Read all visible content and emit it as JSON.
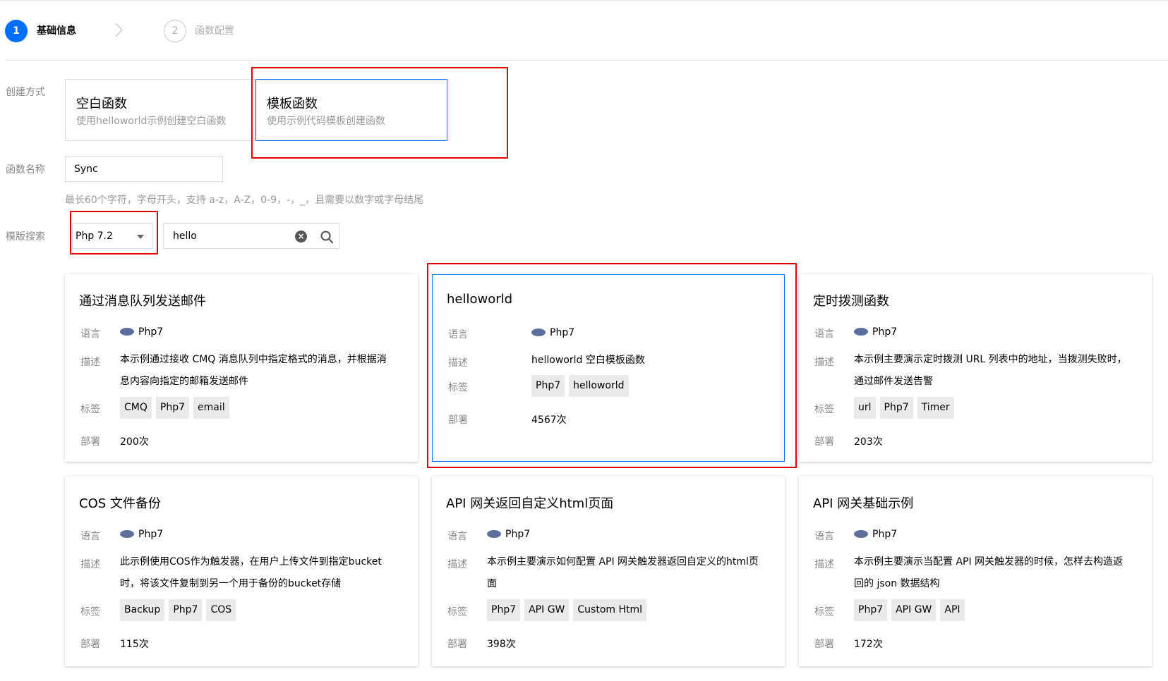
{
  "steps": [
    {
      "number": "1",
      "label": "基础信息"
    },
    {
      "number": "2",
      "label": "函数配置"
    }
  ],
  "form": {
    "creation_method_label": "创建方式",
    "function_name_label": "函数名称",
    "template_search_label": "模版搜索",
    "function_name_value": "Sync",
    "function_name_hint": "最长60个字符，字母开头，支持 a-z，A-Z，0-9，-，_，且需要以数字或字母结尾"
  },
  "methods": [
    {
      "title": "空白函数",
      "desc": "使用helloworld示例创建空白函数"
    },
    {
      "title": "模板函数",
      "desc": "使用示例代码模板创建函数"
    }
  ],
  "search": {
    "runtime_selected": "Php 7.2",
    "query": "hello"
  },
  "row_labels": {
    "language": "语言",
    "description": "描述",
    "tags": "标签",
    "deploys": "部署"
  },
  "templates": [
    {
      "title": "通过消息队列发送邮件",
      "language": "Php7",
      "desc": "本示例通过接收 CMQ 消息队列中指定格式的消息，并根据消息内容向指定的邮箱发送邮件",
      "tags": [
        "CMQ",
        "Php7",
        "email"
      ],
      "deploys": "200次"
    },
    {
      "title": "helloworld",
      "language": "Php7",
      "desc": "helloworld 空白模板函数",
      "tags": [
        "Php7",
        "helloworld"
      ],
      "deploys": "4567次"
    },
    {
      "title": "定时拨测函数",
      "language": "Php7",
      "desc": "本示例主要演示定时拨测 URL 列表中的地址，当拨测失败时，通过邮件发送告警",
      "tags": [
        "url",
        "Php7",
        "Timer"
      ],
      "deploys": "203次"
    },
    {
      "title": "COS 文件备份",
      "language": "Php7",
      "desc": "此示例使用COS作为触发器，在用户上传文件到指定bucket时，将该文件复制到另一个用于备份的bucket存储",
      "tags": [
        "Backup",
        "Php7",
        "COS"
      ],
      "deploys": "115次"
    },
    {
      "title": "API 网关返回自定义html页面",
      "language": "Php7",
      "desc": "本示例主要演示如何配置 API 网关触发器返回自定义的html页面",
      "tags": [
        "Php7",
        "API GW",
        "Custom Html"
      ],
      "deploys": "398次"
    },
    {
      "title": "API 网关基础示例",
      "language": "Php7",
      "desc": "本示例主要演示当配置 API 网关触发器的时候，怎样去构造返回的 json 数据结构",
      "tags": [
        "Php7",
        "API GW",
        "API"
      ],
      "deploys": "172次"
    }
  ],
  "colors": {
    "primary": "#006eff",
    "highlight_box": "#e00000"
  },
  "icons": [
    "chevron-right-icon",
    "clear-icon",
    "search-icon",
    "php-icon",
    "caret-down-icon"
  ]
}
